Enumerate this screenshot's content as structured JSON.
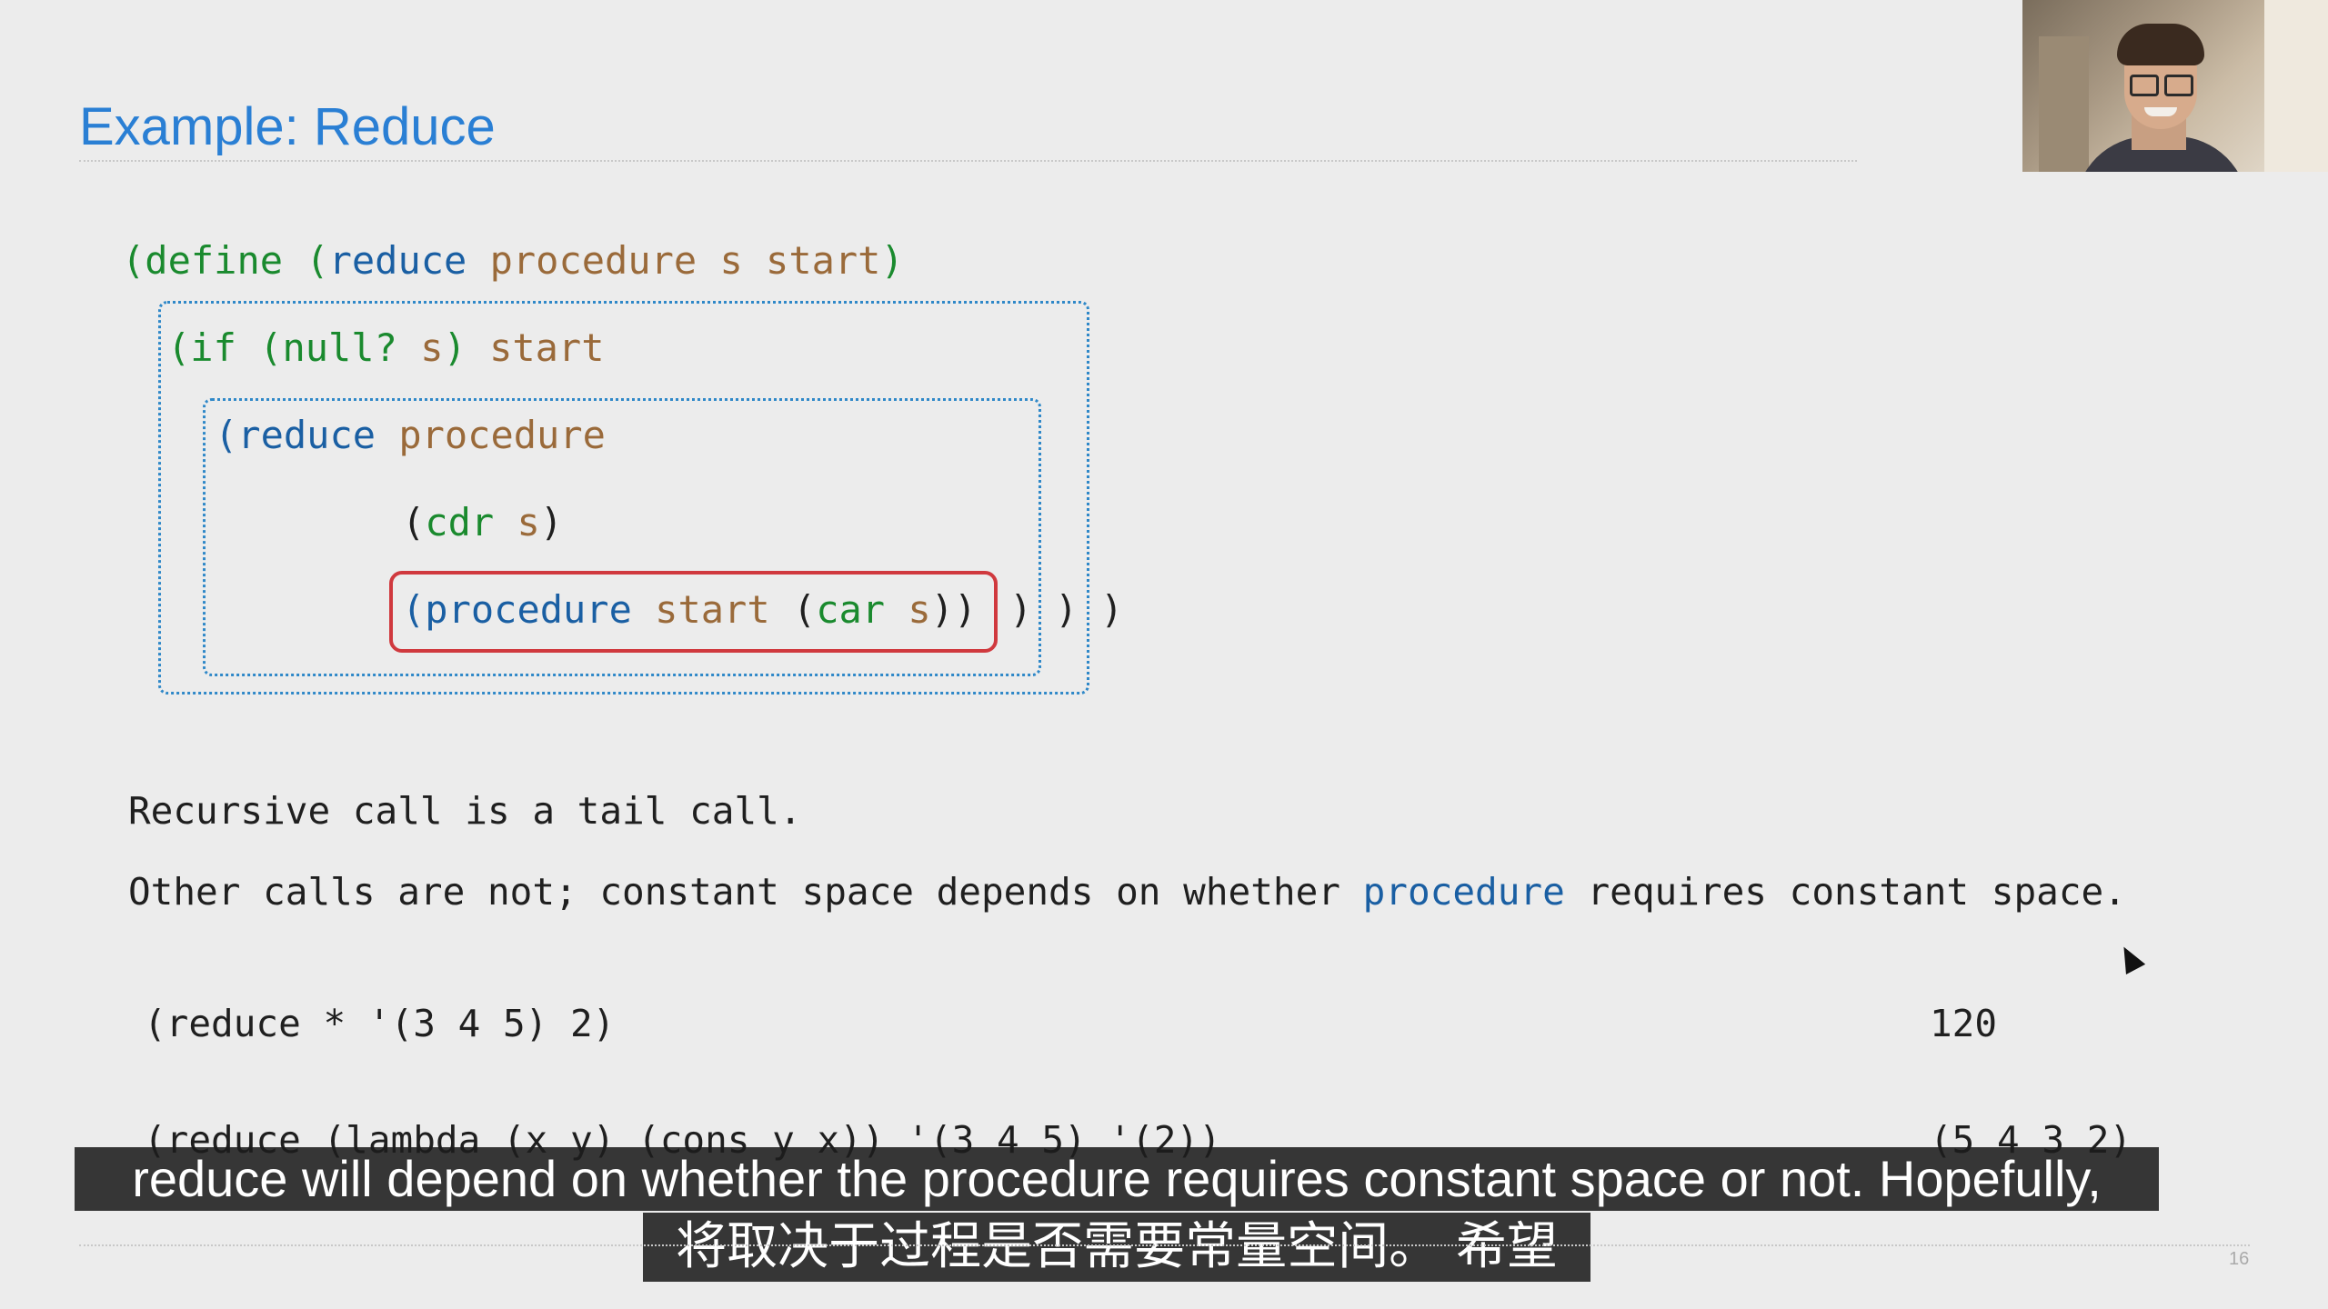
{
  "slide": {
    "title": "Example: Reduce",
    "page_number": "16"
  },
  "code": {
    "line1": {
      "open": "(",
      "kw": "define",
      "sp1": " (",
      "fn": "reduce",
      "args": " procedure s start",
      "close": ")"
    },
    "line2": {
      "open": "(",
      "kw": "if",
      "sp1": " (",
      "kw2": "null?",
      "sp2": " ",
      "var": "s",
      "close": ")",
      "sp3": " ",
      "var2": "start"
    },
    "line3": {
      "open": "(",
      "fn": "reduce",
      "sp1": " ",
      "var": "procedure"
    },
    "line4": {
      "open": "(",
      "kw": "cdr",
      "sp1": " ",
      "var": "s",
      "close": ")"
    },
    "line5": {
      "open": "(",
      "fn": "procedure",
      "sp1": " ",
      "var": "start",
      "sp2": " (",
      "kw": "car",
      "sp3": " ",
      "var2": "s",
      "close_inner": "))",
      "close_rest1": ")",
      "close_rest2": ")",
      "close_rest3": ")"
    }
  },
  "prose": {
    "line1": "Recursive call is a tail call.",
    "line2_a": "Other calls are not; constant space depends on whether ",
    "line2_hl": "procedure",
    "line2_b": " requires constant space."
  },
  "examples": [
    {
      "expr": "(reduce * '(3 4 5) 2)",
      "result": "120"
    },
    {
      "expr": "(reduce (lambda (x y) (cons y x)) '(3 4 5) '(2))",
      "result": "(5 4 3 2)"
    }
  ],
  "subtitles": {
    "english": "reduce will depend on whether the procedure requires constant space or not. Hopefully,",
    "chinese": "将取决于过程是否需要常量空间。 希望"
  }
}
